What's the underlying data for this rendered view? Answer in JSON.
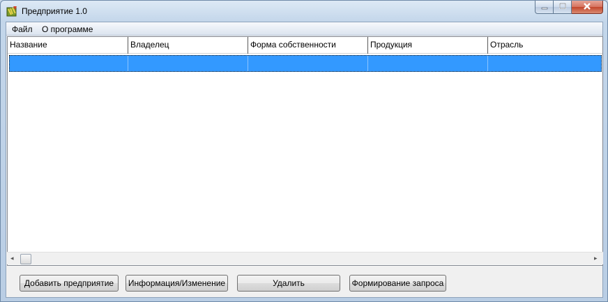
{
  "window": {
    "title": "Предприятие 1.0"
  },
  "icons": {
    "app": "app-icon",
    "minimize": "minimize-icon",
    "maximize": "maximize-icon",
    "close": "close-icon"
  },
  "menu": [
    {
      "label": "Файл"
    },
    {
      "label": "О программе"
    }
  ],
  "table": {
    "columns": [
      "Название",
      "Владелец",
      "Форма собственности",
      "Продукция",
      "Отрасль"
    ],
    "rows": [
      [
        "",
        "",
        "",
        "",
        ""
      ]
    ],
    "selected_row": 0
  },
  "scrollbar": {
    "left": "◂",
    "right": "▸"
  },
  "buttons": {
    "add": "Добавить предприятие",
    "info": "Информация/Изменение",
    "delete": "Удалить",
    "query": "Формирование запроса"
  },
  "colors": {
    "selection": "#3399ff",
    "close_button": "#c3462c"
  }
}
